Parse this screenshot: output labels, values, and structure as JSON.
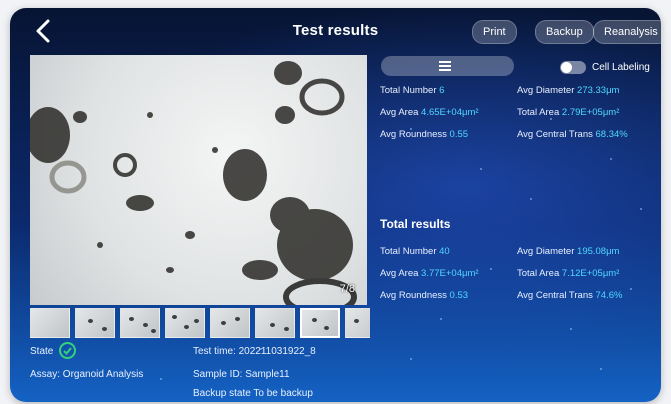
{
  "header": {
    "title": "Test results",
    "print": "Print",
    "backup": "Backup",
    "reanalysis": "Reanalysis"
  },
  "image": {
    "counter": "7/8"
  },
  "info": {
    "state_label": "State",
    "assay": "Assay: Organoid Analysis",
    "test_time": "Test time: 202211031922_8",
    "sample_id": "Sample ID: Sample11",
    "backup_state": "Backup state To be backup"
  },
  "panel": {
    "cell_labeling": "Cell Labeling"
  },
  "current_results": {
    "total_number_label": "Total Number",
    "total_number": "6",
    "avg_diameter_label": "Avg Diameter",
    "avg_diameter": "273.33μm",
    "avg_area_label": "Avg Area",
    "avg_area": "4.65E+04μm²",
    "total_area_label": "Total Area",
    "total_area": "2.79E+05μm²",
    "avg_roundness_label": "Avg Roundness",
    "avg_roundness": "0.55",
    "avg_central_trans_label": "Avg Central Trans",
    "avg_central_trans": "68.34%"
  },
  "total_results": {
    "title": "Total results",
    "total_number_label": "Total Number",
    "total_number": "40",
    "avg_diameter_label": "Avg Diameter",
    "avg_diameter": "195.08μm",
    "avg_area_label": "Avg Area",
    "avg_area": "3.77E+04μm²",
    "total_area_label": "Total Area",
    "total_area": "7.12E+05μm²",
    "avg_roundness_label": "Avg Roundness",
    "avg_roundness": "0.53",
    "avg_central_trans_label": "Avg Central Trans",
    "avg_central_trans": "74.6%"
  },
  "icons": {
    "back": "chevron-left-icon",
    "view": "list-icon",
    "state": "check-circle-icon"
  },
  "colors": {
    "accent_value": "#4fd8ff",
    "state_ok": "#33d27a"
  }
}
